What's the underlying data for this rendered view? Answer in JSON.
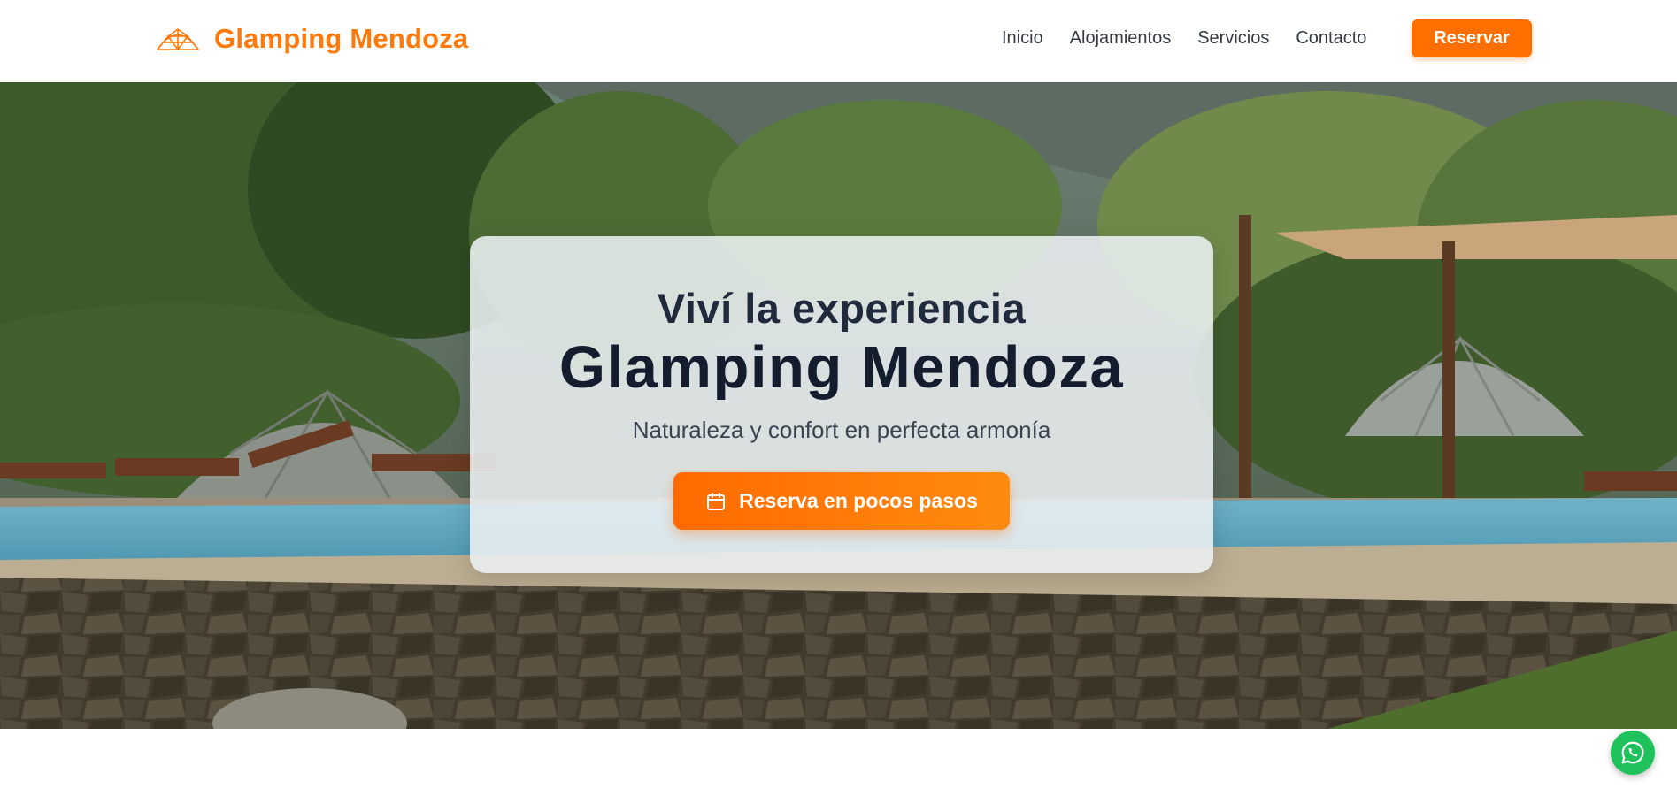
{
  "brand": {
    "name": "Glamping Mendoza",
    "logo_icon": "geodesic-dome-icon",
    "color": "#ff7a0a"
  },
  "nav": {
    "items": [
      {
        "label": "Inicio"
      },
      {
        "label": "Alojamientos"
      },
      {
        "label": "Servicios"
      },
      {
        "label": "Contacto"
      }
    ],
    "reserve_label": "Reservar"
  },
  "hero": {
    "background_icon": "glamping-pool-photo",
    "kicker": "Viví la experiencia",
    "title": "Glamping Mendoza",
    "subtitle": "Naturaleza y confort en perfecta armonía",
    "cta_label": "Reserva en pocos pasos",
    "cta_icon": "calendar-icon"
  },
  "floating": {
    "whatsapp_icon": "whatsapp-icon",
    "whatsapp_color": "#1fc25a"
  },
  "colors": {
    "accent": "#ff6f00",
    "heading": "#141d2e"
  }
}
